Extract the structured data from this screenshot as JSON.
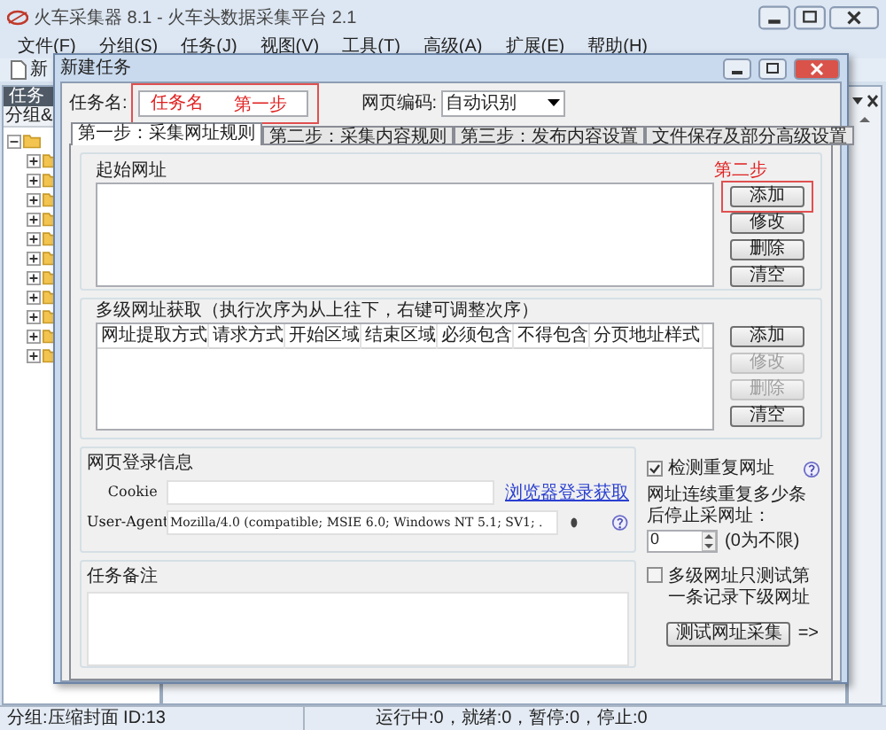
{
  "app_window": {
    "title": "火车采集器 8.1 - 火车头数据采集平台 2.1"
  },
  "menu": [
    "文件(F)",
    "分组(S)",
    "任务(J)",
    "视图(V)",
    "工具(T)",
    "高级(A)",
    "扩展(E)",
    "帮助(H)"
  ],
  "toolbar": {
    "label": "新"
  },
  "left_panel": {
    "header": "任务",
    "column_header": "分组&",
    "tree": {
      "expanded": true,
      "children": [
        {
          "expanded": false
        },
        {
          "expanded": false
        },
        {
          "expanded": false
        },
        {
          "expanded": false
        },
        {
          "expanded": false
        },
        {
          "expanded": false
        },
        {
          "expanded": false
        },
        {
          "expanded": false
        },
        {
          "expanded": false
        },
        {
          "expanded": false
        },
        {
          "expanded": false
        }
      ]
    }
  },
  "dialog": {
    "title": "新建任务",
    "task_name": {
      "label": "任务名:",
      "value": "任务名",
      "highlighted": true,
      "annotation": "第一步"
    },
    "encoding": {
      "label": "网页编码:",
      "value": "自动识别"
    },
    "tabs": [
      {
        "label": "第一步：采集网址规则",
        "selected": true
      },
      {
        "label": "第二步：采集内容规则",
        "selected": false
      },
      {
        "label": "第三步：发布内容设置",
        "selected": false
      },
      {
        "label": "文件保存及部分高级设置",
        "selected": false
      }
    ],
    "start_urls": {
      "title": "起始网址",
      "annotation": "第二步",
      "buttons": [
        {
          "label": "添加",
          "disabled": false,
          "highlighted": true
        },
        {
          "label": "修改",
          "disabled": false,
          "highlighted": false
        },
        {
          "label": "删除",
          "disabled": false,
          "highlighted": false
        },
        {
          "label": "清空",
          "disabled": false,
          "highlighted": false
        }
      ]
    },
    "multi_level": {
      "title": "多级网址获取（执行次序为从上往下，右键可调整次序）",
      "columns": [
        "网址提取方式",
        "请求方式",
        "开始区域",
        "结束区域",
        "必须包含",
        "不得包含",
        "分页地址样式"
      ],
      "buttons": [
        {
          "label": "添加",
          "disabled": false,
          "highlighted": false
        },
        {
          "label": "修改",
          "disabled": true,
          "highlighted": false
        },
        {
          "label": "删除",
          "disabled": true,
          "highlighted": false
        },
        {
          "label": "清空",
          "disabled": false,
          "highlighted": false
        }
      ]
    },
    "login": {
      "title": "网页登录信息",
      "cookie_label": "Cookie",
      "browser_link": "浏览器登录获取",
      "user_agent_label": "User-Agent",
      "user_agent": "Mozilla/4.0 (compatible; MSIE 6.0; Windows NT 5.1; SV1; ."
    },
    "check_duplicates": {
      "label": "检测重复网址",
      "checked": true
    },
    "stop_after": {
      "label": "网址连续重复多少条后停止采网址：",
      "value": "0",
      "hint": "(0为不限)"
    },
    "test_first_only": {
      "label": "多级网址只测试第一条记录下级网址",
      "checked": false
    },
    "notes": {
      "title": "任务备注"
    },
    "test_button": "测试网址采集",
    "arrow": "=>"
  },
  "status_bar": [
    "分组:压缩封面 ID:13",
    "运行中:0，就绪:0，暂停:0，停止:0"
  ]
}
